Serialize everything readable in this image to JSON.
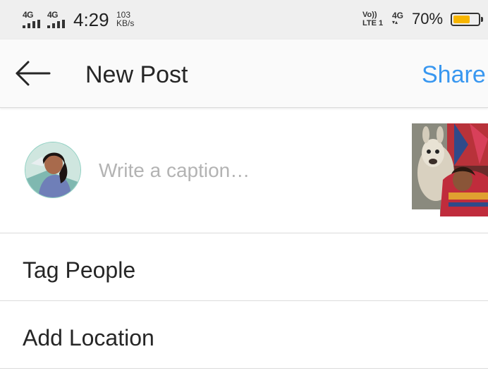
{
  "status_bar": {
    "sim1_network": "4G",
    "sim2_network": "4G",
    "time": "4:29",
    "speed_value": "103",
    "speed_unit": "KB/s",
    "volte_top": "Vo))",
    "volte_bottom": "LTE 1",
    "network_right": "4G",
    "battery_percent": "70%",
    "battery_level": 0.7,
    "battery_color": "#f7b500"
  },
  "header": {
    "back_icon": "arrow-left-icon",
    "title": "New Post",
    "share_label": "Share",
    "share_color": "#3897f0"
  },
  "caption": {
    "placeholder": "Write a caption…",
    "value": ""
  },
  "options": {
    "tag_people": "Tag People",
    "add_location": "Add Location"
  }
}
